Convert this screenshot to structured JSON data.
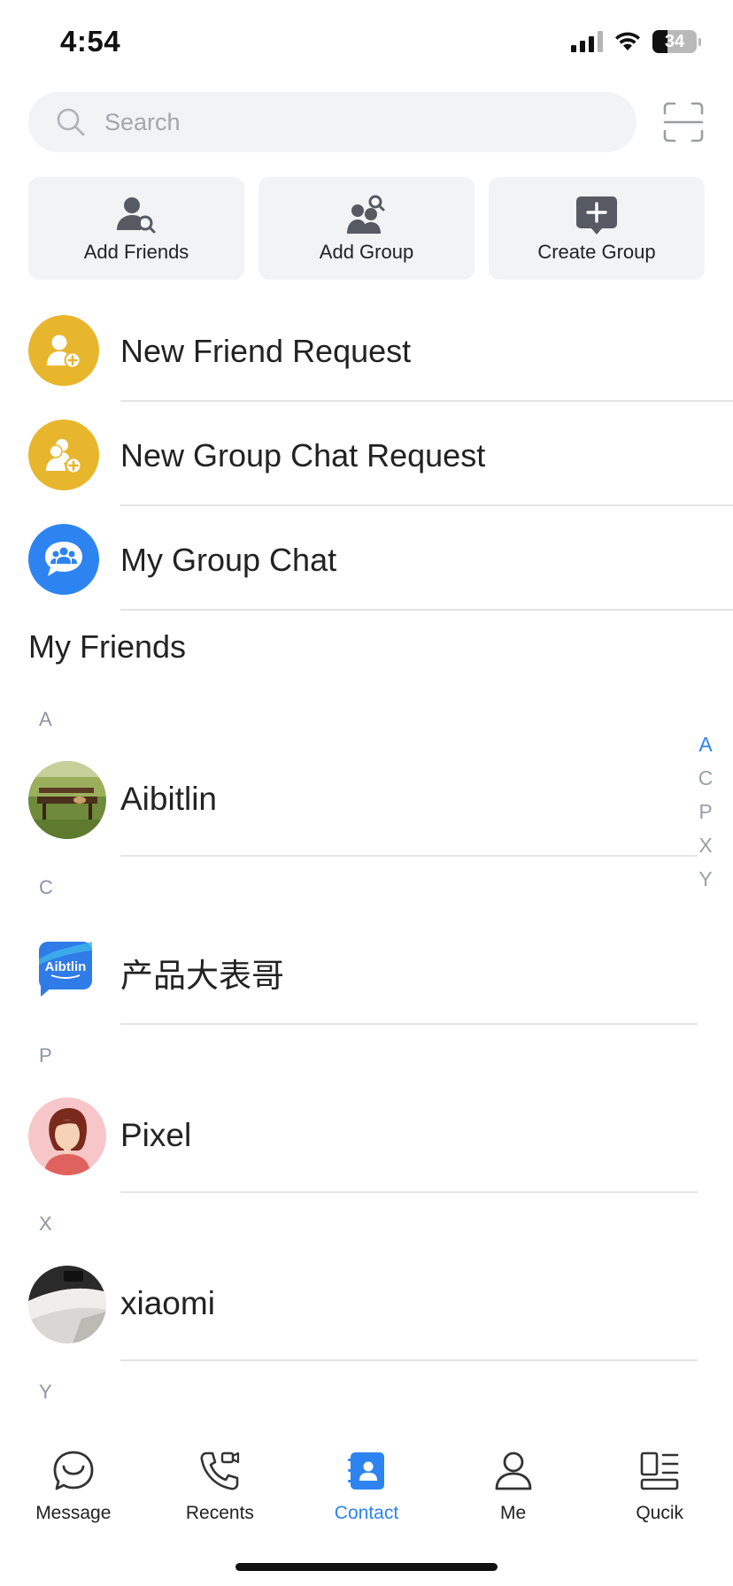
{
  "status_bar": {
    "time": "4:54",
    "battery": "34",
    "battery_level": 0.34
  },
  "search": {
    "placeholder": "Search"
  },
  "quick_actions": [
    {
      "label": "Add Friends",
      "icon": "add-friend-icon"
    },
    {
      "label": "Add Group",
      "icon": "add-group-icon"
    },
    {
      "label": "Create Group",
      "icon": "create-group-icon"
    }
  ],
  "function_rows": [
    {
      "label": "New Friend Request",
      "icon": "friend-request-icon",
      "color": "#e8b62c"
    },
    {
      "label": "New Group Chat Request",
      "icon": "group-request-icon",
      "color": "#e8b62c"
    },
    {
      "label": "My Group Chat",
      "icon": "group-chat-icon",
      "color": "#2d84f1"
    }
  ],
  "friends_section": {
    "title": "My Friends"
  },
  "contacts": {
    "groups": [
      {
        "letter": "A",
        "items": [
          {
            "name": "Aibitlin",
            "avatar": "park-bench-photo"
          }
        ]
      },
      {
        "letter": "C",
        "items": [
          {
            "name": "产品大表哥",
            "avatar": "aibtlin-logo"
          }
        ]
      },
      {
        "letter": "P",
        "items": [
          {
            "name": "Pixel",
            "avatar": "cartoon-woman"
          }
        ]
      },
      {
        "letter": "X",
        "items": [
          {
            "name": "xiaomi",
            "avatar": "desk-photo"
          }
        ]
      },
      {
        "letter": "Y",
        "items": []
      }
    ],
    "logo_text": "Aibtlin"
  },
  "index_bar": {
    "letters": [
      "A",
      "C",
      "P",
      "X",
      "Y"
    ],
    "active": "A"
  },
  "tab_bar": [
    {
      "label": "Message",
      "icon": "message-icon",
      "active": false
    },
    {
      "label": "Recents",
      "icon": "phone-video-icon",
      "active": false
    },
    {
      "label": "Contact",
      "icon": "contact-book-icon",
      "active": true
    },
    {
      "label": "Me",
      "icon": "person-icon",
      "active": false
    },
    {
      "label": "Qucik",
      "icon": "quick-grid-icon",
      "active": false
    }
  ],
  "colors": {
    "accent": "#2d84f1",
    "yellow": "#e8b62c",
    "card_bg": "#f2f3f5"
  }
}
